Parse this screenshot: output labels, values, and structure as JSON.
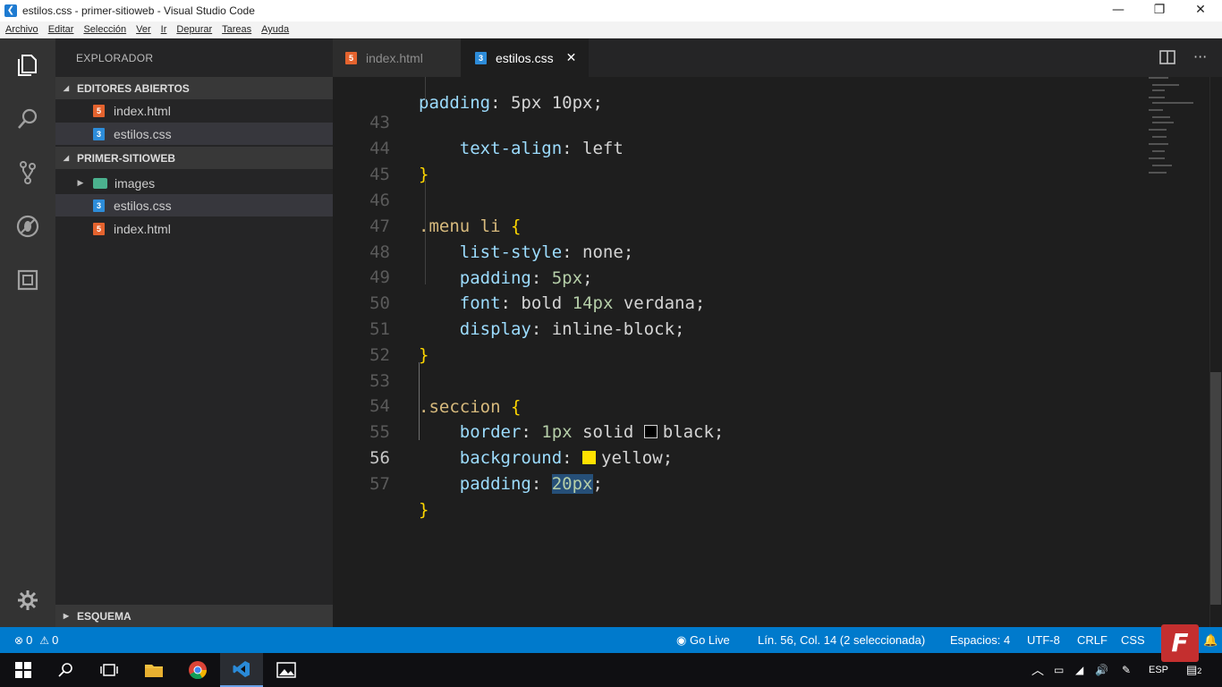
{
  "window": {
    "title": "estilos.css - primer-sitioweb - Visual Studio Code",
    "app_icon": "vscode-icon",
    "controls": [
      "minimize",
      "restore",
      "close"
    ]
  },
  "menubar": [
    "Archivo",
    "Editar",
    "Selección",
    "Ver",
    "Ir",
    "Depurar",
    "Tareas",
    "Ayuda"
  ],
  "activity_bar": [
    "files-icon",
    "search-icon",
    "source-control-icon",
    "debug-icon",
    "extensions-icon",
    "settings-gear-icon"
  ],
  "sidebar": {
    "title": "EXPLORADOR",
    "open_editors_header": "EDITORES ABIERTOS",
    "open_editors": [
      {
        "label": "index.html",
        "type": "html"
      },
      {
        "label": "estilos.css",
        "type": "css"
      }
    ],
    "project_header": "PRIMER-SITIOWEB",
    "project_items": [
      {
        "label": "images",
        "type": "folder"
      },
      {
        "label": "estilos.css",
        "type": "css"
      },
      {
        "label": "index.html",
        "type": "html"
      }
    ],
    "outline_header": "ESQUEMA"
  },
  "tabs": [
    {
      "label": "index.html",
      "active": false
    },
    {
      "label": "estilos.css",
      "active": true
    }
  ],
  "editor": {
    "lines": [
      {
        "n": "43",
        "text": "    text-align: left"
      },
      {
        "n": "44",
        "text": "}"
      },
      {
        "n": "45",
        "text": ""
      },
      {
        "n": "46",
        "text": ".menu li {"
      },
      {
        "n": "47",
        "text": "    list-style: none;"
      },
      {
        "n": "48",
        "text": "    padding: 5px;"
      },
      {
        "n": "49",
        "text": "    font: bold 14px verdana;"
      },
      {
        "n": "50",
        "text": "    display: inline-block;"
      },
      {
        "n": "51",
        "text": "}"
      },
      {
        "n": "52",
        "text": ""
      },
      {
        "n": "53",
        "text": ".seccion {"
      },
      {
        "n": "54",
        "text": "    border: 1px solid black;"
      },
      {
        "n": "55",
        "text": "    background: yellow;"
      },
      {
        "n": "56",
        "text": "    padding: 20px;"
      },
      {
        "n": "57",
        "text": "}"
      }
    ],
    "current_line": "56",
    "swatch_colors": {
      "black": "#000000",
      "yellow": "#ffe100"
    }
  },
  "statusbar": {
    "errors": "0",
    "warnings": "0",
    "go_live": "Go Live",
    "position": "Lín. 56, Col. 14 (2 seleccionada)",
    "spaces": "Espacios: 4",
    "encoding": "UTF-8",
    "eol": "CRLF",
    "language": "CSS",
    "color": "#007acc"
  },
  "taskbar": {
    "icons": [
      "windows-start-icon",
      "search-icon",
      "task-view-icon",
      "file-explorer-icon",
      "chrome-icon",
      "vscode-icon",
      "photos-icon"
    ],
    "language": "ESP",
    "notification_count": "2"
  },
  "watermark": "F"
}
